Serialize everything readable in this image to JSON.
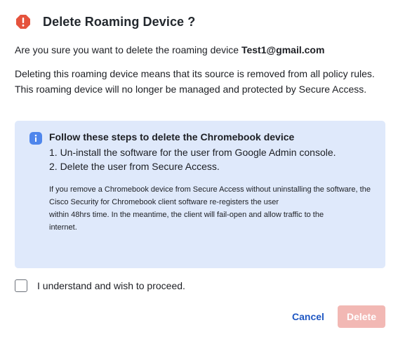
{
  "dialog": {
    "title": "Delete Roaming Device ?",
    "title_icon": "warning-octagon-icon",
    "confirm_prefix": "Are you sure you want to delete the roaming device",
    "device_name": "Test1@gmail.com",
    "description": "Deleting this roaming device means that its source is removed from all policy rules. This roaming device will no longer be managed and protected by Secure Access."
  },
  "info": {
    "icon": "info-icon",
    "title": "Follow these steps to delete the Chromebook device",
    "steps": [
      "1. Un-install the software for the user from Google Admin console.",
      "2. Delete the user from Secure Access."
    ],
    "note_lines": [
      "If you remove a Chromebook device from Secure Access without uninstalling the software, the Cisco Security for Chromebook client software re-registers the user",
      "within 48hrs time. In the meantime, the client will fail-open and allow traffic to the",
      "internet."
    ]
  },
  "consent": {
    "label": "I understand and wish to proceed.",
    "checked": false
  },
  "actions": {
    "cancel_label": "Cancel",
    "delete_label": "Delete",
    "delete_disabled": true
  },
  "colors": {
    "warning": "#e5533d",
    "info_bg": "#dfe9fb",
    "info_icon": "#4f86ec",
    "link": "#1f57c3",
    "delete_disabled_bg": "#f2b8b4"
  }
}
